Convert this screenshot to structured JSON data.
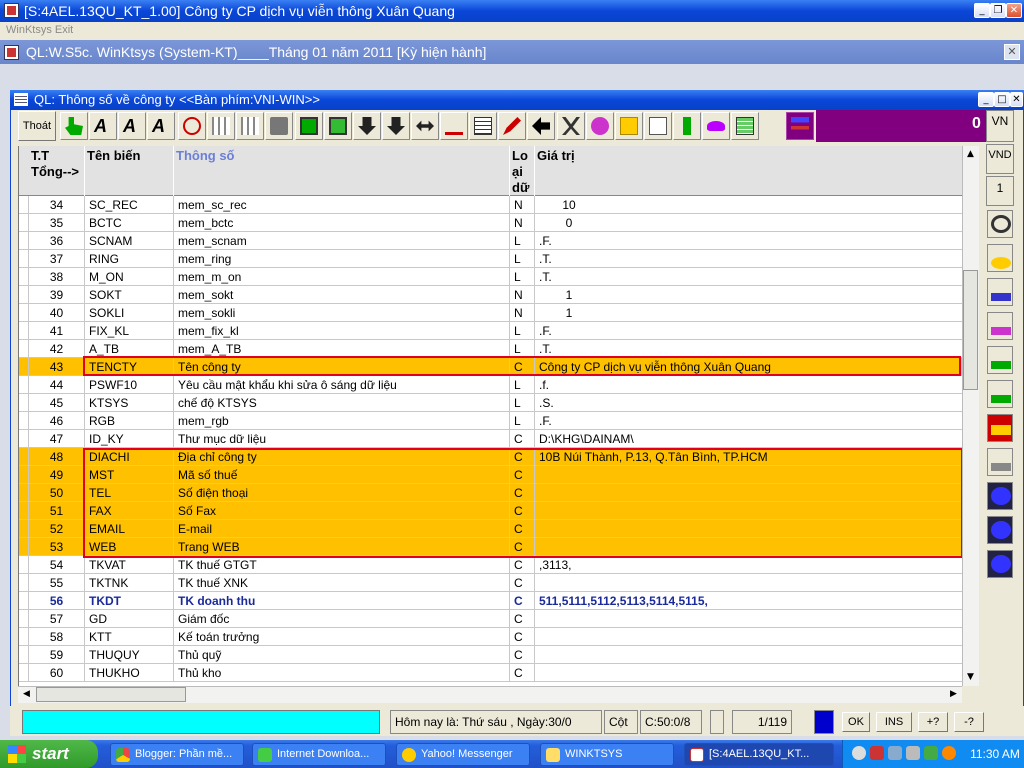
{
  "outer_window": {
    "title": "[S:4AEL.13QU_KT_1.00] Công ty CP dịch vụ viễn thông Xuân Quang"
  },
  "menubar": {
    "label": "WinKtsys Exit"
  },
  "ql_window": {
    "title": "QL:W.S5c. WinKtsys (System-KT)____Tháng  01  năm  2011  [Kỳ hiện hành]"
  },
  "inner_window": {
    "title": "QL: Thông số về công ty    <<Bàn phím:VNI-WIN>>"
  },
  "toolbar": {
    "exit_label": "Thoát",
    "counter": "0"
  },
  "side": {
    "lang": "VN",
    "currency": "VND",
    "num": "1"
  },
  "grid": {
    "headers": {
      "tt": "T.T\nTổng-->",
      "name": "Tên biến",
      "param": "Thông số",
      "type": "Loại dữ liệu",
      "value": "Giá trị"
    },
    "rows": [
      {
        "tt": "34",
        "name": "SC_REC",
        "param": "mem_sc_rec",
        "type": "N",
        "value": "       10"
      },
      {
        "tt": "35",
        "name": "BCTC",
        "param": "mem_bctc",
        "type": "N",
        "value": "        0"
      },
      {
        "tt": "36",
        "name": "SCNAM",
        "param": "mem_scnam",
        "type": "L",
        "value": ".F."
      },
      {
        "tt": "37",
        "name": "RING",
        "param": "mem_ring",
        "type": "L",
        "value": ".T."
      },
      {
        "tt": "38",
        "name": "M_ON",
        "param": "mem_m_on",
        "type": "L",
        "value": ".T."
      },
      {
        "tt": "39",
        "name": "SOKT",
        "param": "mem_sokt",
        "type": "N",
        "value": "        1"
      },
      {
        "tt": "40",
        "name": "SOKLI",
        "param": "mem_sokli",
        "type": "N",
        "value": "        1"
      },
      {
        "tt": "41",
        "name": "FIX_KL",
        "param": "mem_fix_kl",
        "type": "L",
        "value": ".F."
      },
      {
        "tt": "42",
        "name": "A_TB",
        "param": "mem_A_TB",
        "type": "L",
        "value": ".T."
      },
      {
        "tt": "43",
        "name": "TENCTY",
        "param": "Tên công ty",
        "type": "C",
        "value": "Công ty CP dịch vụ viễn thông Xuân Quang"
      },
      {
        "tt": "44",
        "name": "PSWF10",
        "param": "Yêu cầu mật khẩu khi sửa ô sáng dữ liệu",
        "type": "L",
        "value": ".f."
      },
      {
        "tt": "45",
        "name": "KTSYS",
        "param": "chế độ KTSYS",
        "type": "L",
        "value": ".S."
      },
      {
        "tt": "46",
        "name": "RGB",
        "param": "mem_rgb",
        "type": "L",
        "value": ".F."
      },
      {
        "tt": "47",
        "name": "ID_KY",
        "param": "Thư mục dữ liệu",
        "type": "C",
        "value": "D:\\KHG\\DAINAM\\"
      },
      {
        "tt": "48",
        "name": "DIACHI",
        "param": "Địa chỉ công ty",
        "type": "C",
        "value": "10B Núi Thành, P.13, Q.Tân Bình, TP.HCM"
      },
      {
        "tt": "49",
        "name": "MST",
        "param": "Mã số thuế",
        "type": "C",
        "value": ""
      },
      {
        "tt": "50",
        "name": "TEL",
        "param": "Số điện thoại",
        "type": "C",
        "value": ""
      },
      {
        "tt": "51",
        "name": "FAX",
        "param": "Số Fax",
        "type": "C",
        "value": ""
      },
      {
        "tt": "52",
        "name": "EMAIL",
        "param": "E-mail",
        "type": "C",
        "value": ""
      },
      {
        "tt": "53",
        "name": "WEB",
        "param": "Trang WEB",
        "type": "C",
        "value": ""
      },
      {
        "tt": "54",
        "name": "TKVAT",
        "param": "TK thuế GTGT",
        "type": "C",
        "value": ",3113,"
      },
      {
        "tt": "55",
        "name": "TKTNK",
        "param": "TK thuế XNK",
        "type": "C",
        "value": ""
      },
      {
        "tt": "56",
        "name": "TKDT",
        "param": "TK doanh thu",
        "type": "C",
        "value": "511,5111,5112,5113,5114,5115,"
      },
      {
        "tt": "57",
        "name": "GD",
        "param": "Giám đốc",
        "type": "C",
        "value": ""
      },
      {
        "tt": "58",
        "name": "KTT",
        "param": "Kế toán trưởng",
        "type": "C",
        "value": ""
      },
      {
        "tt": "59",
        "name": "THUQUY",
        "param": "Thủ quỹ",
        "type": "C",
        "value": ""
      },
      {
        "tt": "60",
        "name": "THUKHO",
        "param": "Thủ kho",
        "type": "C",
        "value": ""
      }
    ]
  },
  "status": {
    "date_text": "Hôm nay là: Thứ sáu , Ngày:30/0",
    "col_label": "Cột",
    "col_value": "C:50:0/8",
    "record": "1/119",
    "ok": "OK",
    "ins": "INS",
    "plus": "+?",
    "help": "-?"
  },
  "taskbar": {
    "start_label": "start",
    "tasks": [
      "Blogger: Phần mề...",
      "Internet Downloa...",
      "Yahoo! Messenger",
      "WINKTSYS",
      "[S:4AEL.13QU_KT..."
    ],
    "clock": "11:30 AM"
  }
}
